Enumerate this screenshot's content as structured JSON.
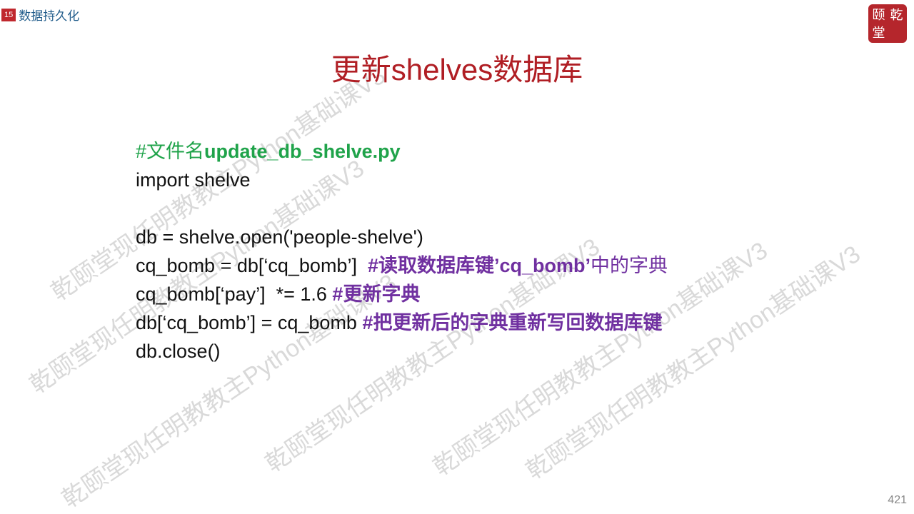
{
  "header": {
    "chapter_number": "15",
    "chapter_title": "数据持久化"
  },
  "logo": {
    "chars": [
      "颐",
      "乾",
      "堂",
      ""
    ]
  },
  "title": "更新shelves数据库",
  "code": {
    "line1_hash": "#",
    "line1_cn": "文件名",
    "line1_file": "update_db_shelve.py",
    "line2": "import shelve",
    "line4": "db = shelve.open('people-shelve')",
    "line5_code": "cq_bomb = db[‘cq_bomb’]  ",
    "line5_c1": "#读取数据库键",
    "line5_c2": "’cq_bomb’",
    "line5_c3": "中的字典",
    "line6_code": "cq_bomb[‘pay’]  *= 1.6 ",
    "line6_comment": "#更新字典",
    "line7_code": "db[‘cq_bomb’] = cq_bomb ",
    "line7_comment": "#把更新后的字典重新写回数据库键",
    "line8": "db.close()"
  },
  "watermark_text": "乾颐堂现任明教教主Python基础课V3",
  "page_number": "421"
}
